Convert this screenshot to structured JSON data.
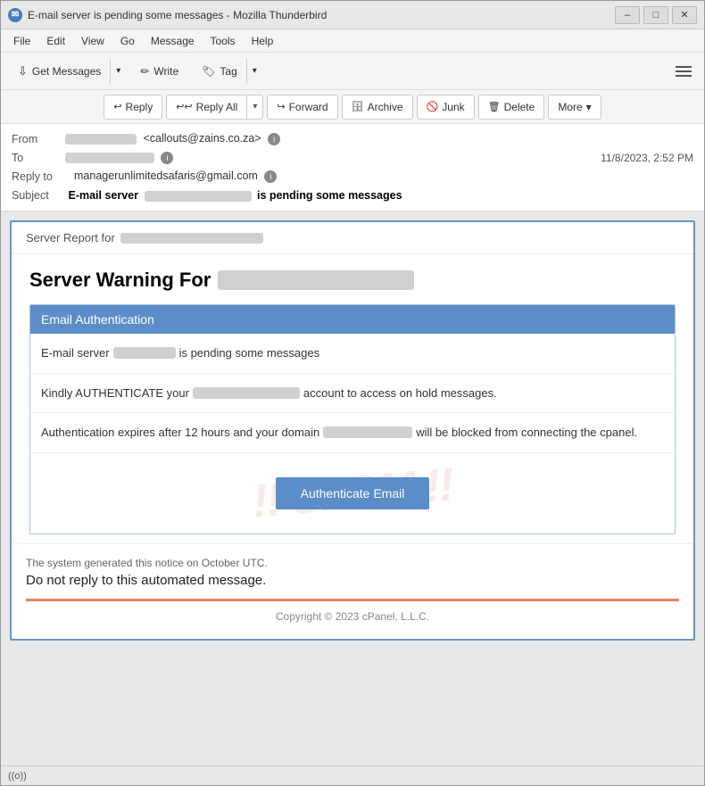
{
  "window": {
    "title": "E-mail server ██████████ is pending some messages - Mozilla Thunderbird",
    "title_display": "E-mail server           is pending some messages - Mozilla Thunderbird"
  },
  "title_controls": {
    "minimize": "–",
    "maximize": "□",
    "close": "✕"
  },
  "menu": {
    "items": [
      "File",
      "Edit",
      "View",
      "Go",
      "Message",
      "Tools",
      "Help"
    ]
  },
  "toolbar": {
    "get_messages": "Get Messages",
    "write": "Write",
    "tag": "Tag"
  },
  "action_toolbar": {
    "reply": "Reply",
    "reply_all": "Reply All",
    "forward": "Forward",
    "archive": "Archive",
    "junk": "Junk",
    "delete": "Delete",
    "more": "More"
  },
  "email": {
    "from_label": "From",
    "from_value": "<callouts@zains.co.za>",
    "to_label": "To",
    "reply_to_label": "Reply to",
    "reply_to_value": "managerunlimitedsafaris@gmail.com",
    "subject_label": "Subject",
    "subject_prefix": "E-mail server",
    "subject_suffix": "is pending some messages",
    "date": "11/8/2023, 2:52 PM"
  },
  "email_body": {
    "server_report_label": "Server Report for",
    "warning_title": "Server Warning For",
    "section_header": "Email Authentication",
    "line1_prefix": "E-mail server",
    "line1_suffix": "is pending some messages",
    "line2_prefix": "Kindly AUTHENTICATE your",
    "line2_suffix": "account to access on hold messages.",
    "line3_prefix": "Authentication expires after 12 hours  and your domain",
    "line3_suffix": "will be blocked from connecting the cpanel.",
    "authenticate_btn": "Authenticate Email",
    "footer_notice": "The system generated this notice on October UTC.",
    "do_not_reply": "Do not reply to this automated message.",
    "copyright": "Copyright © 2023 cPanel, L.L.C.",
    "watermark": "!!! SPAM !!!"
  },
  "status_bar": {
    "wifi_label": "((o))"
  }
}
